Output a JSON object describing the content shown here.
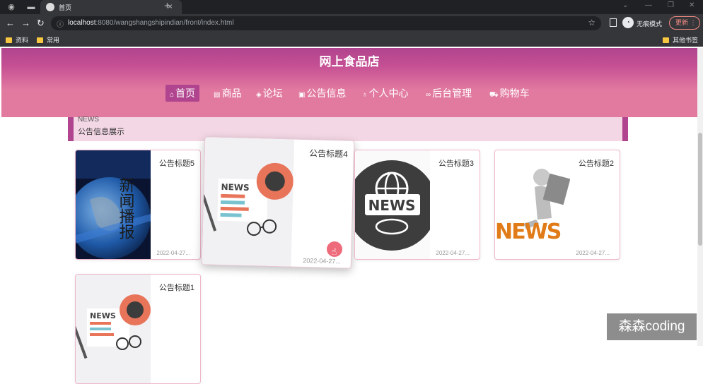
{
  "browser": {
    "tab_title": "首页",
    "url_host": "localhost",
    "url_rest": ":8080/wangshangshipindian/front/index.html",
    "incognito_label": "无痕模式",
    "update_label": "更新",
    "bookmarks": [
      "资料",
      "常用"
    ],
    "other_bookmarks": "其他书签"
  },
  "site": {
    "title": "网上食品店",
    "nav": [
      {
        "label": "首页",
        "icon": "home-icon",
        "glyph": "⌂"
      },
      {
        "label": "商品",
        "icon": "goods-icon",
        "glyph": "▤"
      },
      {
        "label": "论坛",
        "icon": "forum-icon",
        "glyph": "◈"
      },
      {
        "label": "公告信息",
        "icon": "notice-icon",
        "glyph": "▣"
      },
      {
        "label": "个人中心",
        "icon": "user-icon",
        "glyph": "♁"
      },
      {
        "label": "后台管理",
        "icon": "link-icon",
        "glyph": "∞"
      },
      {
        "label": "购物车",
        "icon": "cart-icon",
        "glyph": "⛟"
      }
    ],
    "active_nav": "首页"
  },
  "notice_section": {
    "heading_en": "NEWS",
    "heading_zh": "公告信息展示"
  },
  "cards": [
    {
      "title": "公告标题5",
      "date": "2022-04-27...",
      "thumb": "globe-news-thumb"
    },
    {
      "title": "公告标题4",
      "date": "2022-04-27...",
      "thumb": "newspaper-thumb"
    },
    {
      "title": "公告标题3",
      "date": "2022-04-27...",
      "thumb": "globe-icon-thumb"
    },
    {
      "title": "公告标题2",
      "date": "2022-04-27...",
      "thumb": "figure-news-thumb"
    },
    {
      "title": "公告标题1",
      "date": "2022-04-27...",
      "thumb": "newspaper-thumb"
    }
  ],
  "thumb_text": {
    "news_word": "NEWS",
    "chinese_word": "新闻播报"
  },
  "watermark": "森森coding",
  "colors": {
    "header_dark": "#b0448e",
    "header_light": "#e27aa0",
    "notice_bg": "#f3d7e4"
  }
}
